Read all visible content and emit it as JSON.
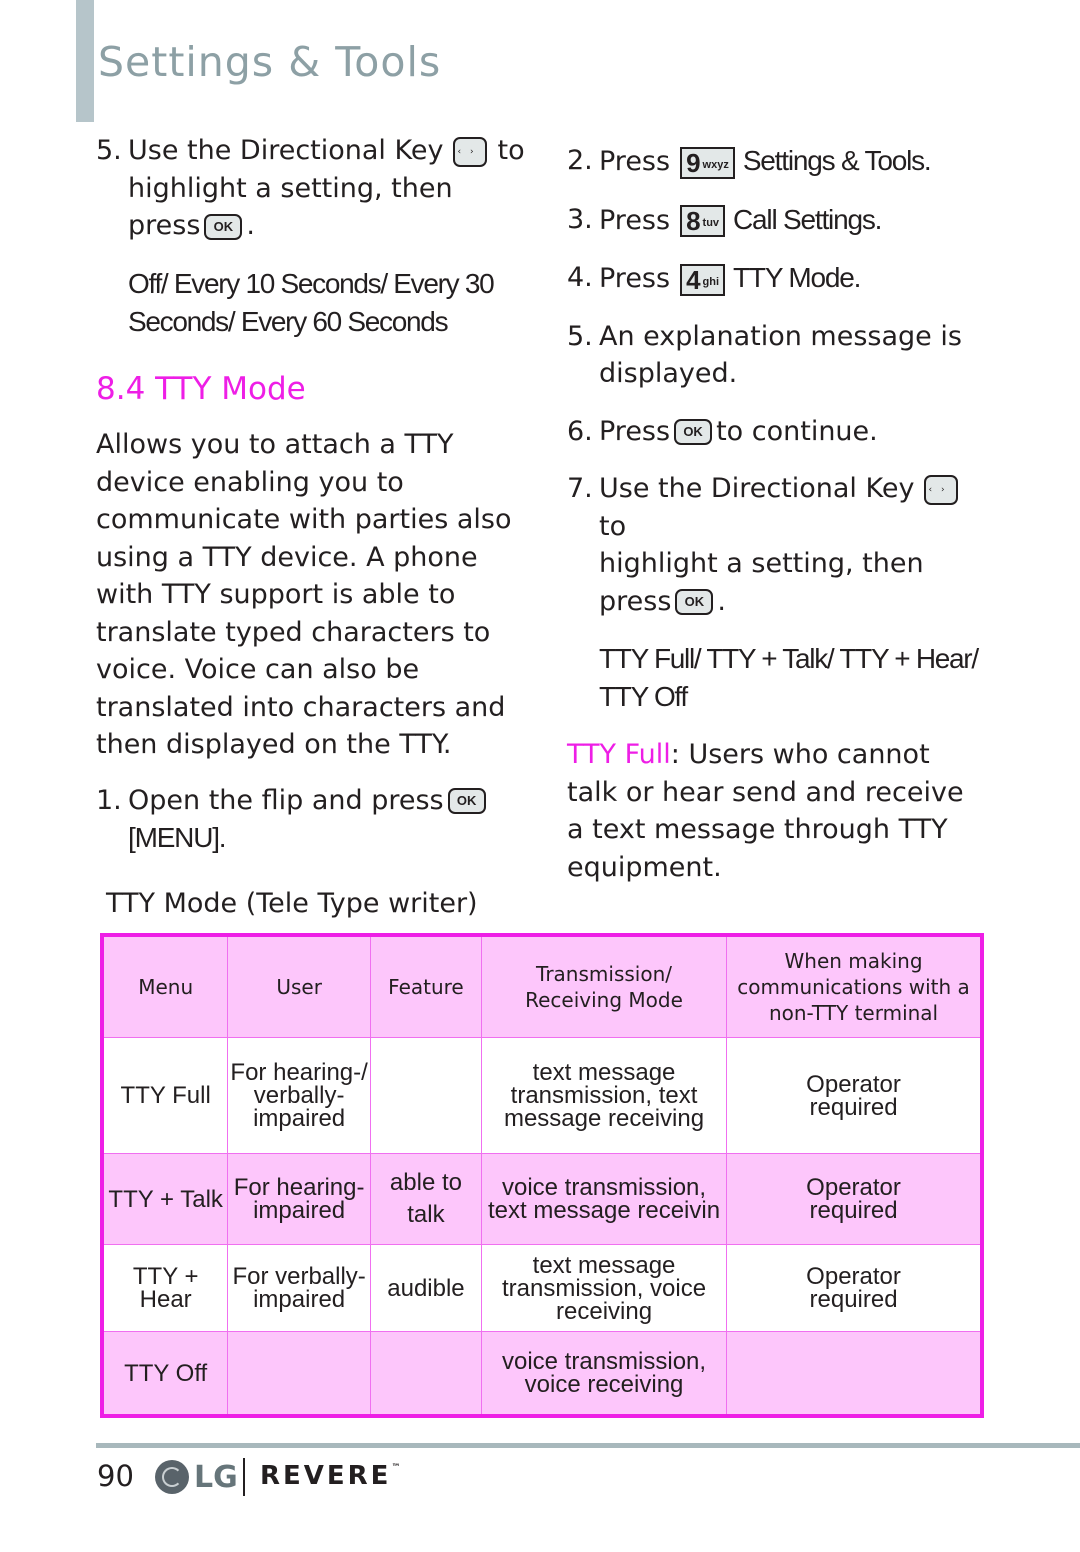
{
  "header": {
    "title": "Settings & Tools"
  },
  "left_column": {
    "step5": {
      "num": "5.",
      "text_before_key": "Use the Directional Key",
      "text_after_key": "to",
      "line2": "highlight a setting, then",
      "line3_before": "press",
      "line3_after": "."
    },
    "step5_options": "Off/ Every 10 Seconds/ Every 30 Seconds/ Every 60 Seconds",
    "section_title": "8.4 TTY Mode",
    "description": "Allows you to attach a TTY device enabling you to communicate with parties also using a TTY device. A phone with TTY support is able to translate typed characters to voice. Voice can also be translated into characters and then displayed on the TTY.",
    "step1": {
      "num": "1.",
      "text_before": "Open the flip and press",
      "text_after": "[MENU]."
    }
  },
  "right_column": {
    "step2": {
      "num": "2.",
      "press": "Press",
      "key_digit": "9",
      "key_letters": "wxyz",
      "label": "Settings & Tools."
    },
    "step3": {
      "num": "3.",
      "press": "Press",
      "key_digit": "8",
      "key_letters": "tuv",
      "label": "Call Settings."
    },
    "step4": {
      "num": "4.",
      "press": "Press",
      "key_digit": "4",
      "key_letters": "ghi",
      "label": "TTY Mode."
    },
    "step5": {
      "num": "5.",
      "text": "An explanation message is displayed."
    },
    "step6": {
      "num": "6.",
      "press": "Press",
      "text_after": "to continue."
    },
    "step7": {
      "num": "7.",
      "text_before_key": "Use the Directional Key",
      "text_after_key": "to",
      "line2": "highlight a setting, then",
      "line3_before": "press",
      "line3_after": "."
    },
    "step7_options": "TTY Full/ TTY + Talk/ TTY + Hear/ TTY Off",
    "note_term": "TTY Full",
    "note_text": ": Users who cannot  talk or hear send and receive a text message through TTY equipment."
  },
  "keys": {
    "ok_label": "OK"
  },
  "table": {
    "caption": "TTY Mode (Tele Type writer)",
    "headers": [
      "Menu",
      "User",
      "Feature",
      "Transmission/ Receiving Mode",
      "When making communications with a non-TTY terminal"
    ],
    "rows": [
      [
        "TTY Full",
        "For hearing-/ verbally-impaired",
        "",
        "text message transmission, text message receiving",
        "Operator required"
      ],
      [
        "TTY + Talk",
        "For hearing-impaired",
        "able to talk",
        "voice transmission, text message receivin",
        "Operator required"
      ],
      [
        "TTY + Hear",
        "For verbally-impaired",
        "audible",
        "text message transmission, voice receiving",
        "Operator required"
      ],
      [
        "TTY Off",
        "",
        "",
        "voice transmission, voice receiving",
        ""
      ]
    ]
  },
  "footer": {
    "page_number": "90",
    "lg_text": "LG",
    "brand": "REVERE",
    "trademark": "™"
  },
  "colors": {
    "accent_magenta": "#ee1ee6",
    "table_fill_pink": "#fdc6fb",
    "header_gray": "#8da0a5",
    "rule_gray": "#a8b8bc"
  }
}
